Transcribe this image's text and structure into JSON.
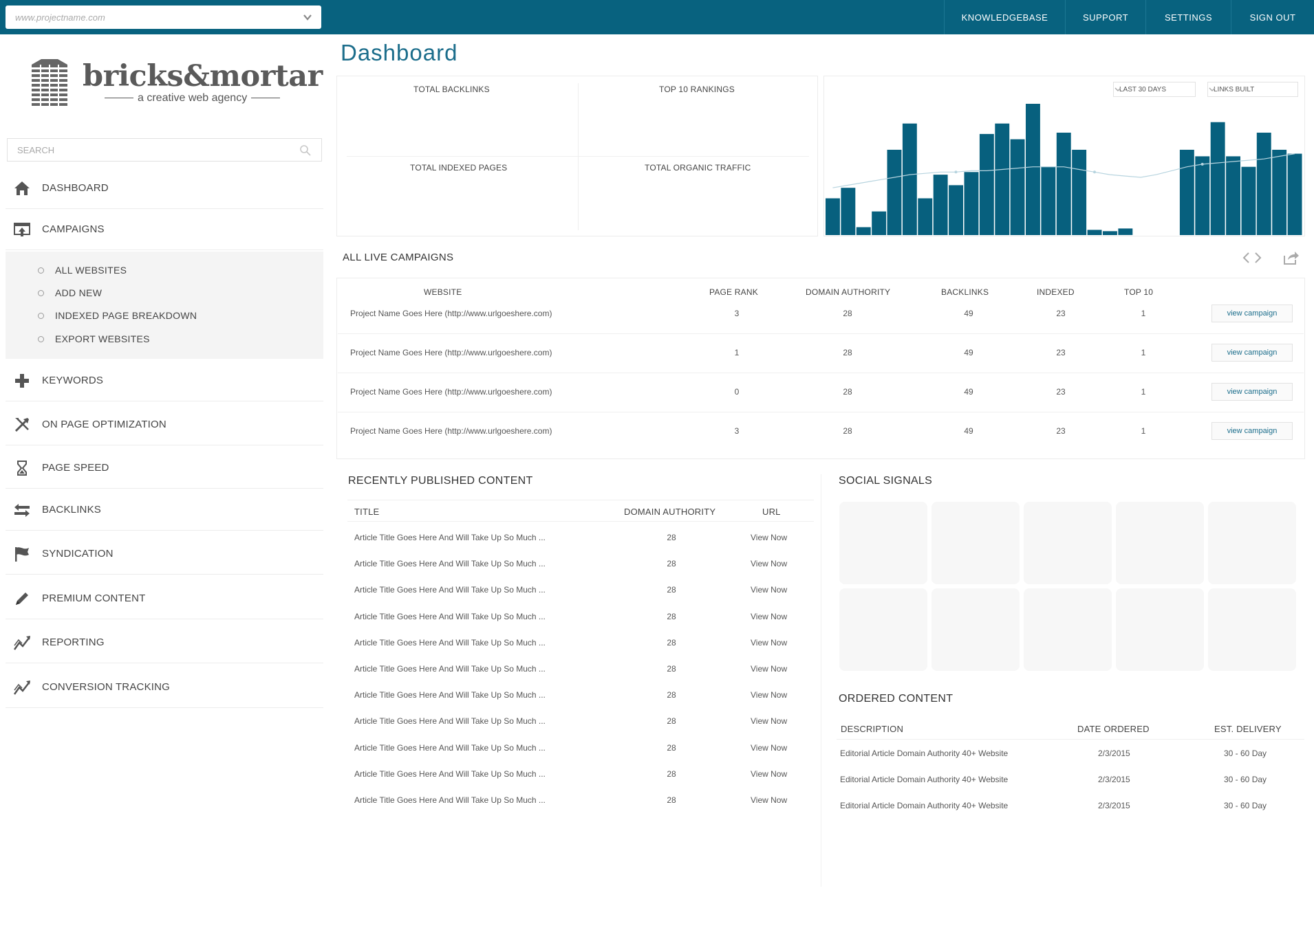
{
  "topbar": {
    "url_value": "www.projectname.com",
    "nav": [
      "KNOWLEDGEBASE",
      "SUPPORT",
      "SETTINGS",
      "SIGN OUT"
    ]
  },
  "brand": {
    "name": "bricks&mortar",
    "tagline": "a creative web agency"
  },
  "sidebar": {
    "search_placeholder": "SEARCH",
    "items": [
      {
        "label": "DASHBOARD",
        "icon": "home-icon"
      },
      {
        "label": "CAMPAIGNS",
        "icon": "upload-icon"
      },
      {
        "label": "KEYWORDS",
        "icon": "plus-icon"
      },
      {
        "label": "ON PAGE OPTIMIZATION",
        "icon": "tools-icon"
      },
      {
        "label": "PAGE SPEED",
        "icon": "hourglass-icon"
      },
      {
        "label": "BACKLINKS",
        "icon": "arrows-icon"
      },
      {
        "label": "SYNDICATION",
        "icon": "flag-icon"
      },
      {
        "label": "PREMIUM CONTENT",
        "icon": "pencil-icon"
      },
      {
        "label": "REPORTING",
        "icon": "trend-icon"
      },
      {
        "label": "CONVERSION TRACKING",
        "icon": "trend-icon"
      }
    ],
    "campaign_sub": [
      "ALL WEBSITES",
      "ADD NEW",
      "INDEXED PAGE BREAKDOWN",
      "EXPORT WEBSITES"
    ]
  },
  "page_title": "Dashboard",
  "stats": {
    "total_backlinks": "TOTAL BACKLINKS",
    "top10": "TOP 10 RANKINGS",
    "indexed": "TOTAL INDEXED PAGES",
    "organic": "TOTAL ORGANIC TRAFFIC"
  },
  "chart": {
    "range_select": "LAST 30 DAYS",
    "metric_select": "LINKS BUILT",
    "bar_color": "#07607e",
    "line_color": "#b7d4df"
  },
  "chart_data": {
    "type": "bar",
    "values": [
      28,
      36,
      6,
      18,
      65,
      85,
      28,
      46,
      38,
      48,
      77,
      85,
      73,
      100,
      52,
      78,
      65,
      4,
      3,
      5,
      0,
      0,
      0,
      65,
      60,
      86,
      60,
      52,
      78,
      65,
      62
    ],
    "trend": [
      36,
      38,
      40,
      42,
      44,
      46,
      47,
      48,
      48,
      49,
      49,
      50,
      51,
      52,
      52,
      52,
      50,
      48,
      46,
      45,
      44,
      46,
      49,
      52,
      54,
      55,
      56,
      57,
      58,
      60,
      62
    ],
    "ylim": [
      0,
      100
    ]
  },
  "campaigns": {
    "title": "ALL LIVE CAMPAIGNS",
    "headers": [
      "WEBSITE",
      "PAGE RANK",
      "DOMAIN AUTHORITY",
      "BACKLINKS",
      "INDEXED",
      "TOP 10"
    ],
    "button_label": "view campaign",
    "rows": [
      {
        "site": "Project Name Goes Here (http://www.urlgoeshere.com)",
        "pr": "3",
        "da": "28",
        "bl": "49",
        "idx": "23",
        "top": "1"
      },
      {
        "site": "Project Name Goes Here (http://www.urlgoeshere.com)",
        "pr": "1",
        "da": "28",
        "bl": "49",
        "idx": "23",
        "top": "1"
      },
      {
        "site": "Project Name Goes Here (http://www.urlgoeshere.com)",
        "pr": "0",
        "da": "28",
        "bl": "49",
        "idx": "23",
        "top": "1"
      },
      {
        "site": "Project Name Goes Here (http://www.urlgoeshere.com)",
        "pr": "3",
        "da": "28",
        "bl": "49",
        "idx": "23",
        "top": "1"
      }
    ]
  },
  "recent": {
    "title": "RECENTLY PUBLISHED CONTENT",
    "headers": [
      "TITLE",
      "DOMAIN AUTHORITY",
      "URL"
    ],
    "rows": [
      {
        "title": "Article Title Goes Here And Will Take Up So Much ...",
        "da": "28",
        "url": "View Now"
      },
      {
        "title": "Article Title Goes Here And Will Take Up So Much ...",
        "da": "28",
        "url": "View Now"
      },
      {
        "title": "Article Title Goes Here And Will Take Up So Much ...",
        "da": "28",
        "url": "View Now"
      },
      {
        "title": "Article Title Goes Here And Will Take Up So Much ...",
        "da": "28",
        "url": "View Now"
      },
      {
        "title": "Article Title Goes Here And Will Take Up So Much ...",
        "da": "28",
        "url": "View Now"
      },
      {
        "title": "Article Title Goes Here And Will Take Up So Much ...",
        "da": "28",
        "url": "View Now"
      },
      {
        "title": "Article Title Goes Here And Will Take Up So Much ...",
        "da": "28",
        "url": "View Now"
      },
      {
        "title": "Article Title Goes Here And Will Take Up So Much ...",
        "da": "28",
        "url": "View Now"
      },
      {
        "title": "Article Title Goes Here And Will Take Up So Much ...",
        "da": "28",
        "url": "View Now"
      },
      {
        "title": "Article Title Goes Here And Will Take Up So Much ...",
        "da": "28",
        "url": "View Now"
      },
      {
        "title": "Article Title Goes Here And Will Take Up So Much ...",
        "da": "28",
        "url": "View Now"
      }
    ]
  },
  "social": {
    "title": "SOCIAL SIGNALS"
  },
  "ordered": {
    "title": "ORDERED CONTENT",
    "headers": [
      "DESCRIPTION",
      "DATE ORDERED",
      "EST. DELIVERY"
    ],
    "rows": [
      {
        "desc": "Editorial Article Domain Authority 40+ Website",
        "date": "2/3/2015",
        "eta": "30 - 60 Day"
      },
      {
        "desc": "Editorial Article Domain Authority 40+ Website",
        "date": "2/3/2015",
        "eta": "30 - 60 Day"
      },
      {
        "desc": "Editorial Article Domain Authority 40+ Website",
        "date": "2/3/2015",
        "eta": "30 - 60 Day"
      }
    ]
  }
}
